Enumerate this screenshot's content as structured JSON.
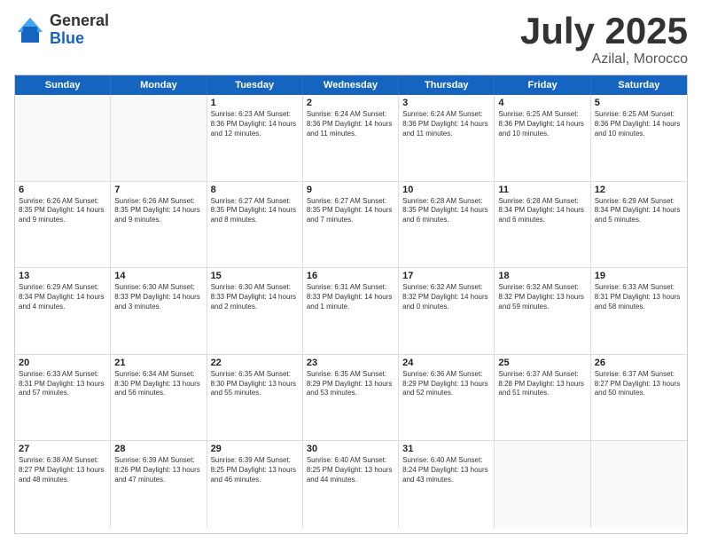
{
  "logo": {
    "general": "General",
    "blue": "Blue"
  },
  "title": {
    "month_year": "July 2025",
    "location": "Azilal, Morocco"
  },
  "header_days": [
    "Sunday",
    "Monday",
    "Tuesday",
    "Wednesday",
    "Thursday",
    "Friday",
    "Saturday"
  ],
  "weeks": [
    [
      {
        "day": "",
        "detail": ""
      },
      {
        "day": "",
        "detail": ""
      },
      {
        "day": "1",
        "detail": "Sunrise: 6:23 AM\nSunset: 8:36 PM\nDaylight: 14 hours\nand 12 minutes."
      },
      {
        "day": "2",
        "detail": "Sunrise: 6:24 AM\nSunset: 8:36 PM\nDaylight: 14 hours\nand 11 minutes."
      },
      {
        "day": "3",
        "detail": "Sunrise: 6:24 AM\nSunset: 8:36 PM\nDaylight: 14 hours\nand 11 minutes."
      },
      {
        "day": "4",
        "detail": "Sunrise: 6:25 AM\nSunset: 8:36 PM\nDaylight: 14 hours\nand 10 minutes."
      },
      {
        "day": "5",
        "detail": "Sunrise: 6:25 AM\nSunset: 8:36 PM\nDaylight: 14 hours\nand 10 minutes."
      }
    ],
    [
      {
        "day": "6",
        "detail": "Sunrise: 6:26 AM\nSunset: 8:35 PM\nDaylight: 14 hours\nand 9 minutes."
      },
      {
        "day": "7",
        "detail": "Sunrise: 6:26 AM\nSunset: 8:35 PM\nDaylight: 14 hours\nand 9 minutes."
      },
      {
        "day": "8",
        "detail": "Sunrise: 6:27 AM\nSunset: 8:35 PM\nDaylight: 14 hours\nand 8 minutes."
      },
      {
        "day": "9",
        "detail": "Sunrise: 6:27 AM\nSunset: 8:35 PM\nDaylight: 14 hours\nand 7 minutes."
      },
      {
        "day": "10",
        "detail": "Sunrise: 6:28 AM\nSunset: 8:35 PM\nDaylight: 14 hours\nand 6 minutes."
      },
      {
        "day": "11",
        "detail": "Sunrise: 6:28 AM\nSunset: 8:34 PM\nDaylight: 14 hours\nand 6 minutes."
      },
      {
        "day": "12",
        "detail": "Sunrise: 6:29 AM\nSunset: 8:34 PM\nDaylight: 14 hours\nand 5 minutes."
      }
    ],
    [
      {
        "day": "13",
        "detail": "Sunrise: 6:29 AM\nSunset: 8:34 PM\nDaylight: 14 hours\nand 4 minutes."
      },
      {
        "day": "14",
        "detail": "Sunrise: 6:30 AM\nSunset: 8:33 PM\nDaylight: 14 hours\nand 3 minutes."
      },
      {
        "day": "15",
        "detail": "Sunrise: 6:30 AM\nSunset: 8:33 PM\nDaylight: 14 hours\nand 2 minutes."
      },
      {
        "day": "16",
        "detail": "Sunrise: 6:31 AM\nSunset: 8:33 PM\nDaylight: 14 hours\nand 1 minute."
      },
      {
        "day": "17",
        "detail": "Sunrise: 6:32 AM\nSunset: 8:32 PM\nDaylight: 14 hours\nand 0 minutes."
      },
      {
        "day": "18",
        "detail": "Sunrise: 6:32 AM\nSunset: 8:32 PM\nDaylight: 13 hours\nand 59 minutes."
      },
      {
        "day": "19",
        "detail": "Sunrise: 6:33 AM\nSunset: 8:31 PM\nDaylight: 13 hours\nand 58 minutes."
      }
    ],
    [
      {
        "day": "20",
        "detail": "Sunrise: 6:33 AM\nSunset: 8:31 PM\nDaylight: 13 hours\nand 57 minutes."
      },
      {
        "day": "21",
        "detail": "Sunrise: 6:34 AM\nSunset: 8:30 PM\nDaylight: 13 hours\nand 56 minutes."
      },
      {
        "day": "22",
        "detail": "Sunrise: 6:35 AM\nSunset: 8:30 PM\nDaylight: 13 hours\nand 55 minutes."
      },
      {
        "day": "23",
        "detail": "Sunrise: 6:35 AM\nSunset: 8:29 PM\nDaylight: 13 hours\nand 53 minutes."
      },
      {
        "day": "24",
        "detail": "Sunrise: 6:36 AM\nSunset: 8:29 PM\nDaylight: 13 hours\nand 52 minutes."
      },
      {
        "day": "25",
        "detail": "Sunrise: 6:37 AM\nSunset: 8:28 PM\nDaylight: 13 hours\nand 51 minutes."
      },
      {
        "day": "26",
        "detail": "Sunrise: 6:37 AM\nSunset: 8:27 PM\nDaylight: 13 hours\nand 50 minutes."
      }
    ],
    [
      {
        "day": "27",
        "detail": "Sunrise: 6:38 AM\nSunset: 8:27 PM\nDaylight: 13 hours\nand 48 minutes."
      },
      {
        "day": "28",
        "detail": "Sunrise: 6:39 AM\nSunset: 8:26 PM\nDaylight: 13 hours\nand 47 minutes."
      },
      {
        "day": "29",
        "detail": "Sunrise: 6:39 AM\nSunset: 8:25 PM\nDaylight: 13 hours\nand 46 minutes."
      },
      {
        "day": "30",
        "detail": "Sunrise: 6:40 AM\nSunset: 8:25 PM\nDaylight: 13 hours\nand 44 minutes."
      },
      {
        "day": "31",
        "detail": "Sunrise: 6:40 AM\nSunset: 8:24 PM\nDaylight: 13 hours\nand 43 minutes."
      },
      {
        "day": "",
        "detail": ""
      },
      {
        "day": "",
        "detail": ""
      }
    ]
  ]
}
